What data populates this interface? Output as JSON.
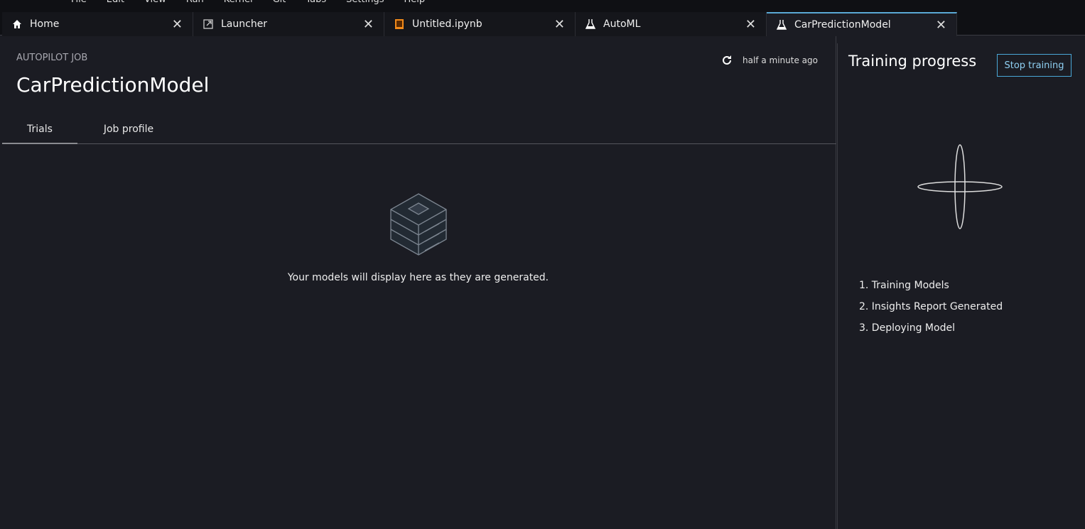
{
  "menu": [
    "File",
    "Edit",
    "View",
    "Run",
    "Kernel",
    "Git",
    "Tabs",
    "Settings",
    "Help"
  ],
  "tabs": [
    {
      "label": "Home",
      "icon": "home-icon"
    },
    {
      "label": "Launcher",
      "icon": "launch-icon"
    },
    {
      "label": "Untitled.ipynb",
      "icon": "notebook-icon"
    },
    {
      "label": "AutoML",
      "icon": "flask-icon"
    },
    {
      "label": "CarPredictionModel",
      "icon": "flask-icon",
      "active": true
    }
  ],
  "job": {
    "eyebrow": "AUTOPILOT JOB",
    "title": "CarPredictionModel",
    "updated": "half a minute ago"
  },
  "subtabs": [
    {
      "label": "Trials",
      "active": true
    },
    {
      "label": "Job profile"
    }
  ],
  "empty_message": "Your models will display here as they are generated.",
  "progress": {
    "title": "Training progress",
    "stop_label": "Stop training",
    "steps": [
      "1.  Training Models",
      "2.  Insights Report Generated",
      "3.  Deploying Model"
    ]
  },
  "colors": {
    "accent": "#4aa8d8",
    "notebook": "#f28a1a"
  }
}
